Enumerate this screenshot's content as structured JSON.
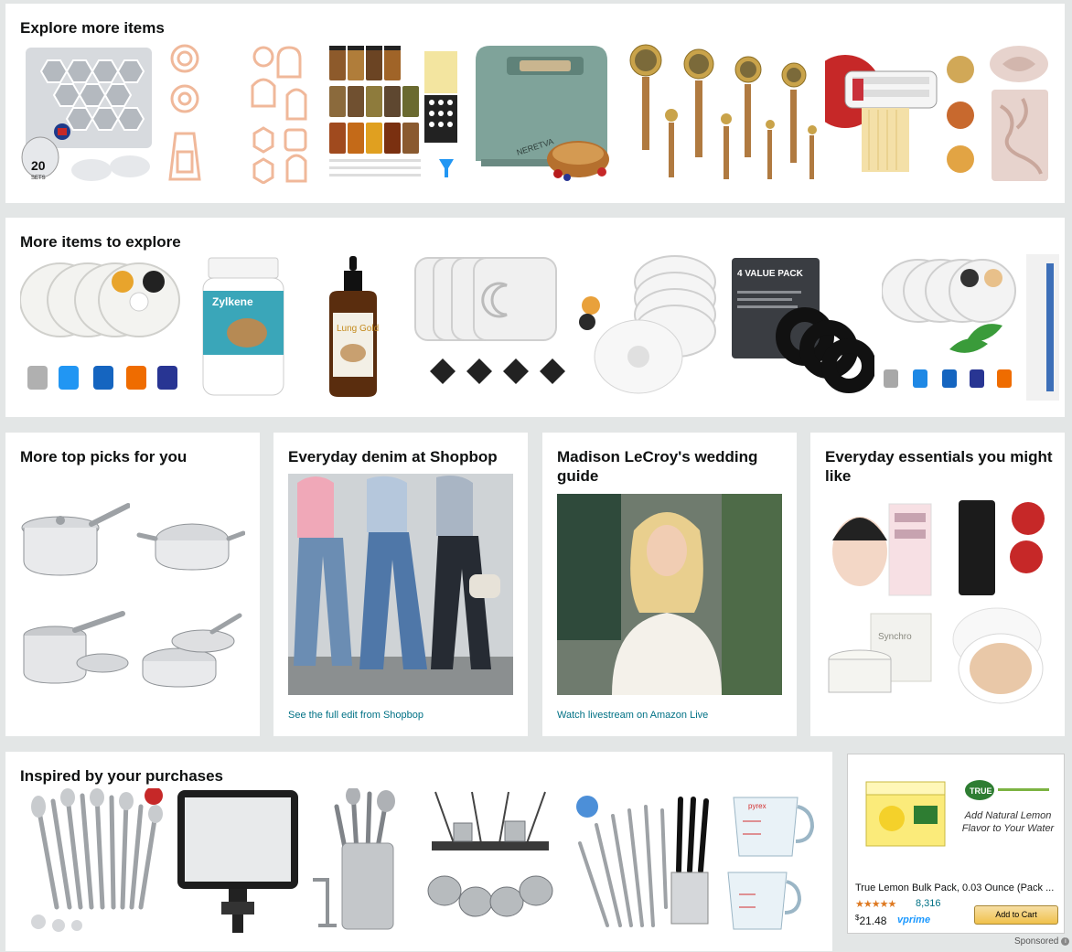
{
  "row1": {
    "title": "Explore more items",
    "items": [
      {
        "icon": "spice-jar-rack-set-icon",
        "badge": "20",
        "badge_sub": "SETS"
      },
      {
        "icon": "clay-cutter-shapes-icon"
      },
      {
        "icon": "clay-cutter-arch-shapes-icon"
      },
      {
        "icon": "spice-jars-with-labels-icon"
      },
      {
        "icon": "bread-maker-icon",
        "brand": "NERETVA"
      },
      {
        "icon": "measuring-spoons-icon"
      },
      {
        "icon": "pasta-maker-attachment-icon"
      },
      {
        "icon": "silicone-baroque-mold-icon"
      }
    ]
  },
  "row2": {
    "title": "More items to explore",
    "items": [
      {
        "icon": "pet-fountain-filters-icon"
      },
      {
        "icon": "zylkene-supplement-bottle-icon",
        "brand": "Zylkene"
      },
      {
        "icon": "lung-gold-dropper-bottle-icon",
        "brand": "Lung Gold"
      },
      {
        "icon": "square-fountain-filters-icon"
      },
      {
        "icon": "round-fountain-filters-icon"
      },
      {
        "icon": "foam-filter-pack-icon",
        "brand": "4 VALUE PACK"
      },
      {
        "icon": "fountain-filters-mint-icon"
      },
      {
        "icon": "partial-product-icon"
      }
    ]
  },
  "cards": {
    "top_picks": {
      "title": "More top picks for you",
      "items": [
        {
          "icon": "stainless-saucepan-icon"
        },
        {
          "icon": "stainless-saute-pan-icon"
        },
        {
          "icon": "stainless-pot-lid-icon"
        },
        {
          "icon": "stainless-skillet-lid-icon"
        }
      ]
    },
    "denim": {
      "title": "Everyday denim at Shopbop",
      "link": "See the full edit from Shopbop"
    },
    "wedding": {
      "title": "Madison LeCroy's wedding guide",
      "link": "Watch livestream on Amazon Live"
    },
    "essentials": {
      "title": "Everyday essentials you might like",
      "items": [
        {
          "icon": "sheet-mask-icon"
        },
        {
          "icon": "black-tube-cream-icon"
        },
        {
          "icon": "synchro-cream-jar-icon",
          "brand": "Synchro"
        },
        {
          "icon": "cushion-compact-icon"
        }
      ]
    }
  },
  "row4": {
    "title": "Inspired by your purchases",
    "items": [
      {
        "icon": "kitchen-utensil-set-icon"
      },
      {
        "icon": "led-video-light-panel-icon"
      },
      {
        "icon": "utensil-holder-crock-icon"
      },
      {
        "icon": "hanging-pot-rack-icon"
      },
      {
        "icon": "stainless-utensil-set-icon"
      },
      {
        "icon": "pyrex-measuring-cups-icon",
        "brand": "pyrex"
      }
    ]
  },
  "ad": {
    "logo": "TRUE LEMON",
    "tagline": "Add Natural Lemon Flavor to Your Water",
    "product_name": "True Lemon Bulk Pack, 0.03 Ounce (Pack ...",
    "rating": 4.5,
    "stars": "★★★★★",
    "review_count": "8,316",
    "price_symbol": "$",
    "price": "21.48",
    "prime_label": "vprime",
    "cta": "Add to Cart",
    "sponsored": "Sponsored"
  },
  "colors": {
    "page_bg": "#e3e6e6",
    "link": "#007185",
    "star": "#de7921",
    "button": "#f0c14b"
  }
}
